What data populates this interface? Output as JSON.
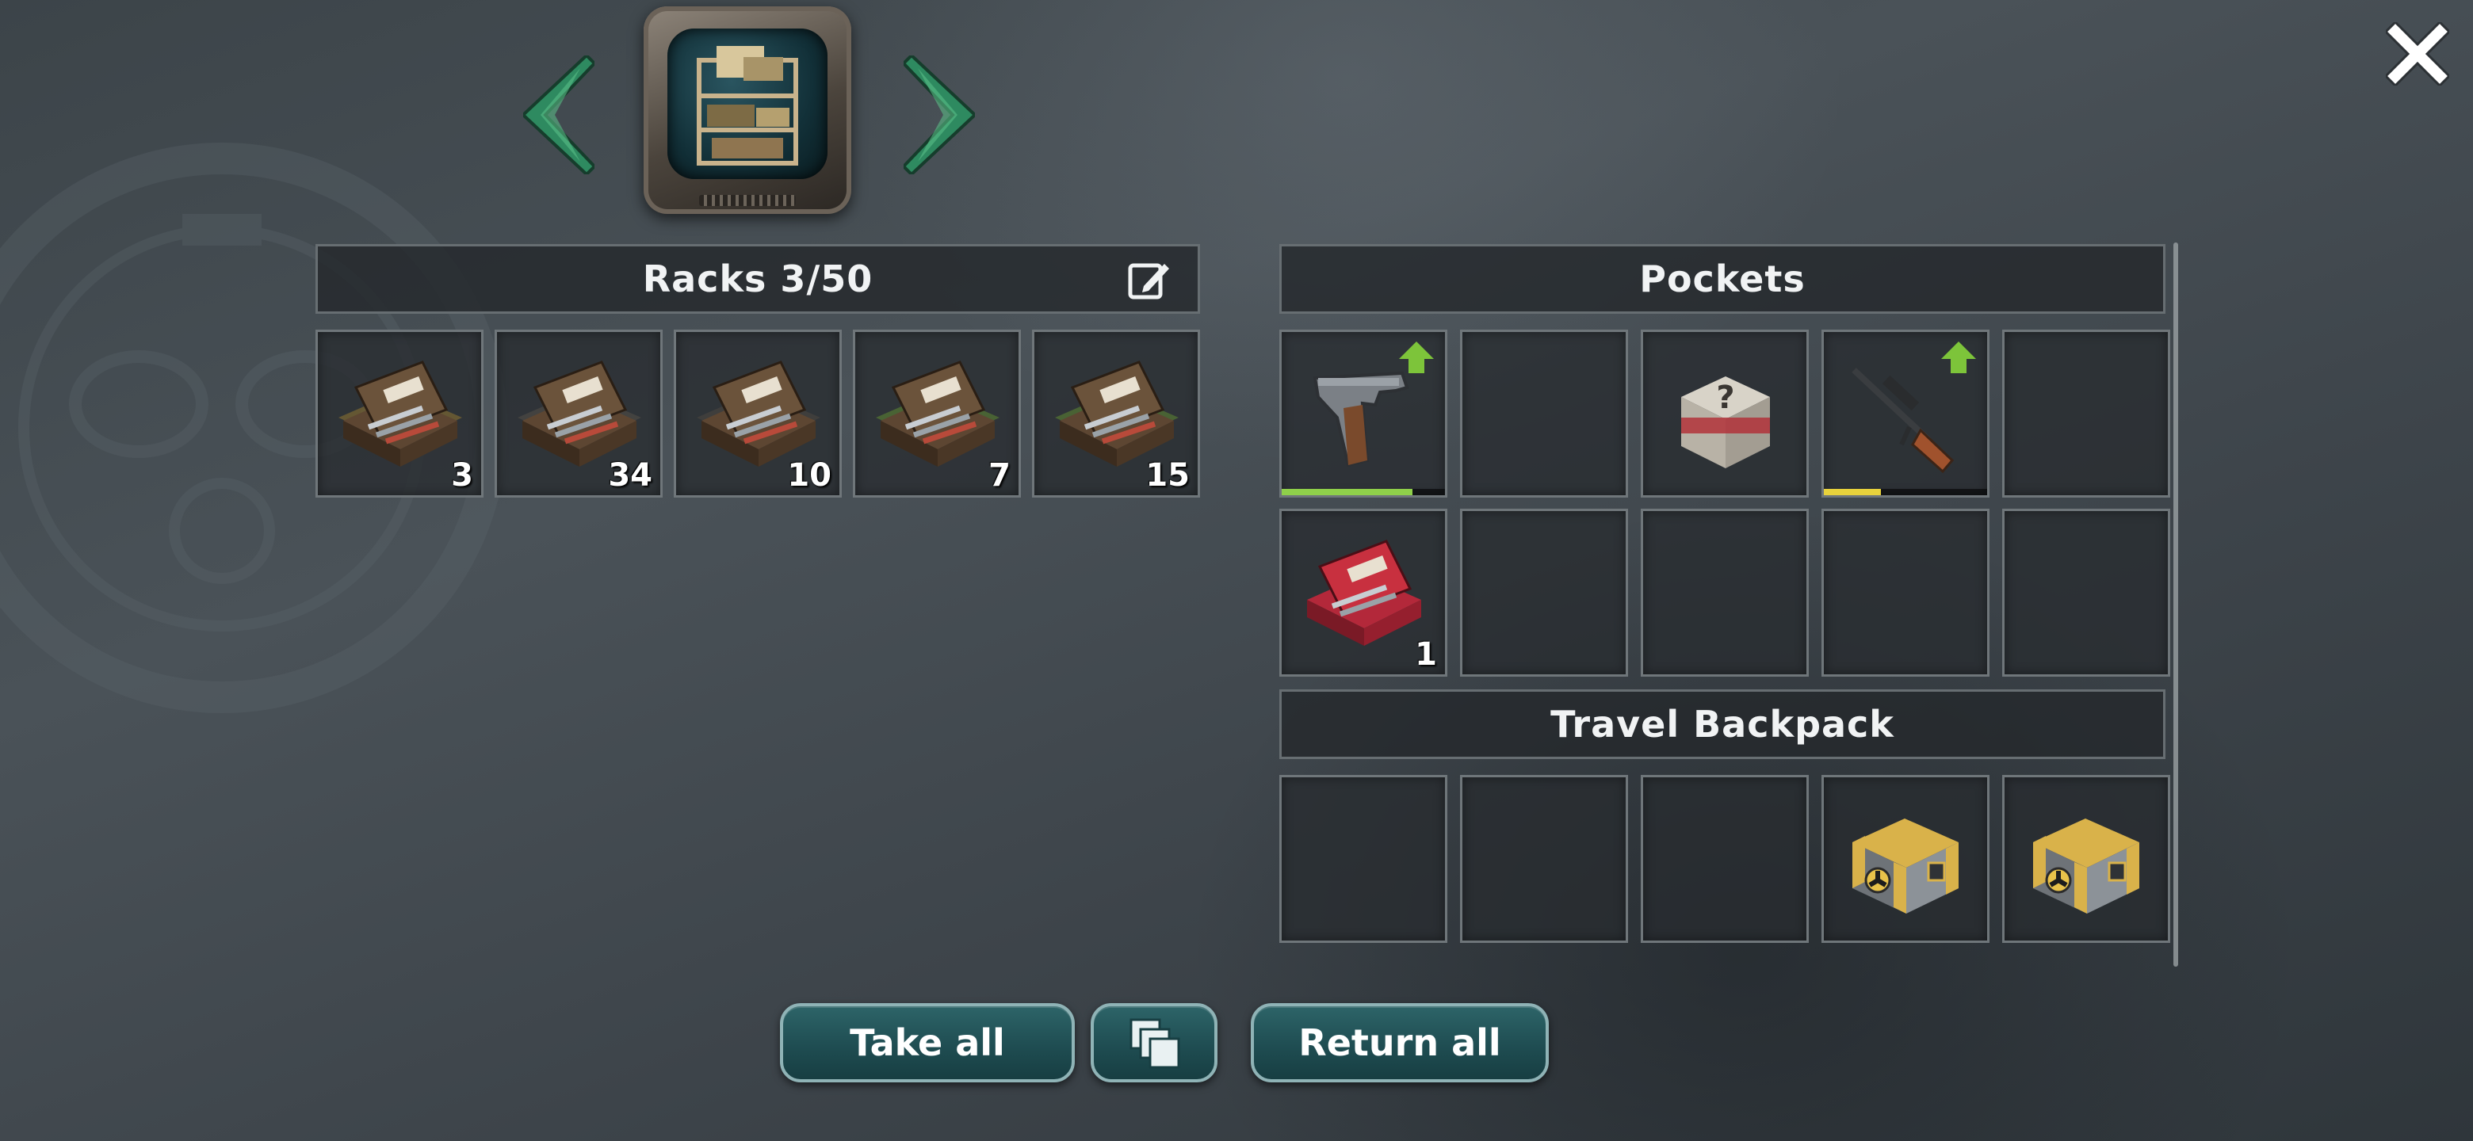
{
  "racks": {
    "title": "Racks 3/50",
    "edit_icon": "edit-icon",
    "items": [
      {
        "name": "toolbox-gold",
        "count": "3",
        "rarity_color": "#f2b62a"
      },
      {
        "name": "toolbox-brown",
        "count": "34",
        "rarity_color": "#7a6a55"
      },
      {
        "name": "toolbox-brown-open",
        "count": "10",
        "rarity_color": "#6a5848"
      },
      {
        "name": "toolbox-green",
        "count": "7",
        "rarity_color": "#8fe02a"
      },
      {
        "name": "toolbox-green-open",
        "count": "15",
        "rarity_color": "#8fe02a"
      }
    ]
  },
  "pockets": {
    "title": "Pockets",
    "items": [
      {
        "name": "pistol",
        "upgrade_available": true,
        "durability": 0.8,
        "durability_color": "#8fd04a"
      },
      {
        "name": "empty"
      },
      {
        "name": "mystery-crate"
      },
      {
        "name": "sniper-rifle",
        "upgrade_available": true,
        "durability": 0.35,
        "durability_color": "#e8d23c"
      },
      {
        "name": "empty"
      },
      {
        "name": "toolbox-red",
        "count": "1",
        "rarity_color": "#d93a4a"
      },
      {
        "name": "empty"
      },
      {
        "name": "empty"
      },
      {
        "name": "empty"
      },
      {
        "name": "empty"
      }
    ]
  },
  "backpack": {
    "title": "Travel Backpack",
    "items": [
      {
        "name": "empty"
      },
      {
        "name": "empty"
      },
      {
        "name": "empty"
      },
      {
        "name": "gold-radioactive-chest"
      },
      {
        "name": "gold-radioactive-chest"
      }
    ]
  },
  "buttons": {
    "take_all": "Take all",
    "stack_icon": "stack-icon",
    "return_all": "Return all"
  },
  "colors": {
    "accent_teal": "#1f4d52",
    "upgrade_green": "#7dc43a",
    "nav_arrow": "#2e8a60"
  }
}
